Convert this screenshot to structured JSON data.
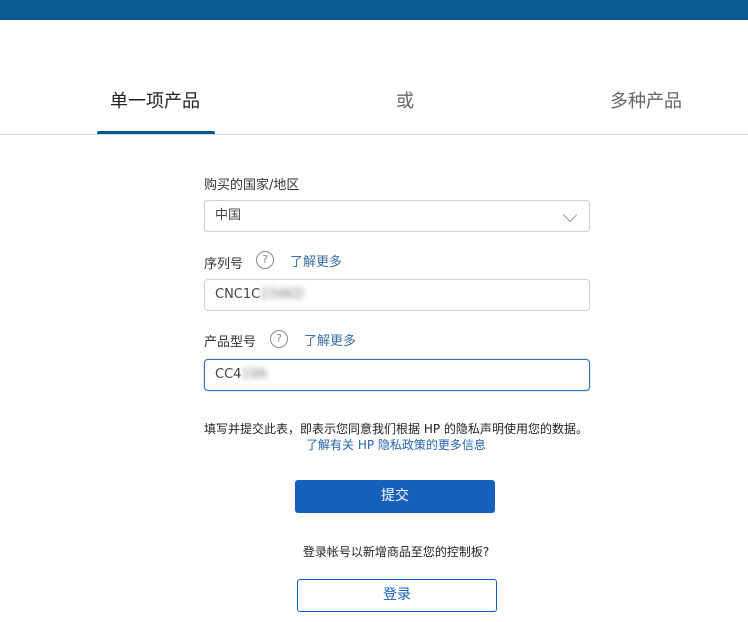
{
  "tabs": {
    "single": "单一项产品",
    "or": "或",
    "multiple": "多种产品"
  },
  "form": {
    "country_label": "购买的国家/地区",
    "country_value": "中国",
    "serial_label": "序列号",
    "serial_help": "?",
    "serial_learn_more": "了解更多",
    "serial_value_visible": "CNC1C",
    "serial_value_hidden": "234KD",
    "model_label": "产品型号",
    "model_help": "?",
    "model_learn_more": "了解更多",
    "model_value_visible": "CC4",
    "model_value_hidden": "19A"
  },
  "consent": {
    "text": "填写并提交此表，即表示您同意我们根据 HP 的隐私声明使用您的数据。",
    "link": "了解有关 HP 隐私政策的更多信息"
  },
  "actions": {
    "submit": "提交",
    "login_prompt": "登录帐号以新增商品至您的控制板?",
    "login": "登录"
  },
  "colors": {
    "top_bar": "#0b5b92",
    "primary": "#1560bd",
    "link": "#2565ae"
  }
}
